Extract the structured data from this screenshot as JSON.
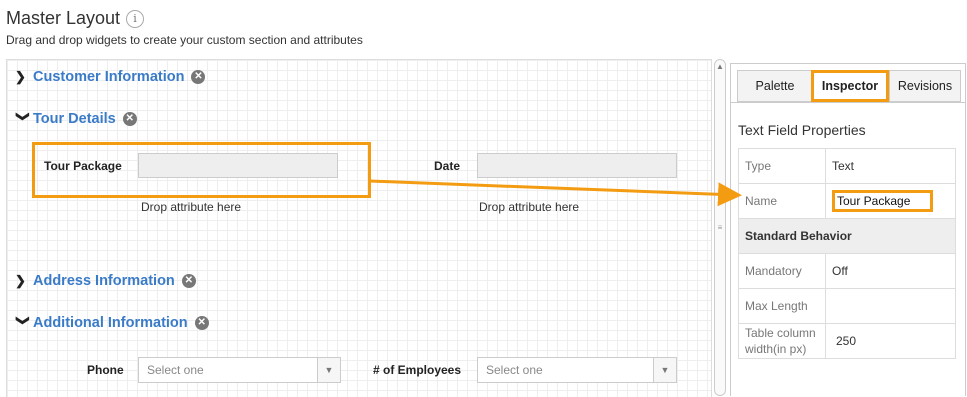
{
  "header": {
    "title": "Master Layout",
    "info_icon": "i",
    "subtitle": "Drag and drop widgets to create your custom section and attributes"
  },
  "sections": {
    "customer": {
      "label": "Customer Information",
      "expanded": false
    },
    "tour": {
      "label": "Tour Details",
      "expanded": true
    },
    "address": {
      "label": "Address Information",
      "expanded": false
    },
    "additional": {
      "label": "Additional Information",
      "expanded": true
    }
  },
  "icons": {
    "collapsed": "chevron-right-icon",
    "expanded": "chevron-down-icon",
    "remove": "close-circle-icon"
  },
  "tour_fields": {
    "tour_package_label": "Tour Package",
    "date_label": "Date",
    "drop_hint_1": "Drop attribute here",
    "drop_hint_2": "Drop attribute here"
  },
  "additional_fields": {
    "phone_label": "Phone",
    "phone_select": "Select one",
    "employees_label": "# of Employees",
    "employees_select": "Select one"
  },
  "panel": {
    "tabs": [
      "Palette",
      "Inspector",
      "Revisions"
    ],
    "active_tab": "Inspector",
    "props_title": "Text Field Properties",
    "rows": {
      "type_key": "Type",
      "type_val": "Text",
      "name_key": "Name",
      "name_val": "Tour Package",
      "group": "Standard Behavior",
      "mandatory_key": "Mandatory",
      "mandatory_val": "Off",
      "maxlen_key": "Max Length",
      "maxlen_val": "",
      "colwidth_key": "Table column width(in px)",
      "colwidth_val": "250"
    }
  },
  "colors": {
    "accent_orange": "#f39c12",
    "link_blue": "#3a7bc8"
  }
}
